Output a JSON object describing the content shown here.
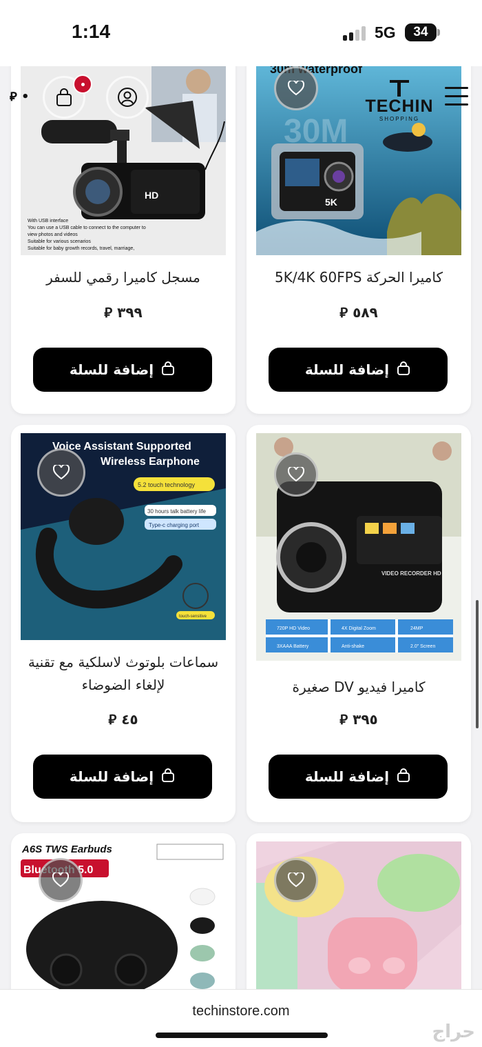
{
  "status_bar": {
    "time": "1:14",
    "network": "5G",
    "battery": "34"
  },
  "header": {
    "logo_text": "TECHIN",
    "logo_subtext": "SHOPPING",
    "cart_count_icon": "bag-icon",
    "currency_symbol": "⃁"
  },
  "products": [
    {
      "title": "مسجل كاميرا رقمي للسفر",
      "price": "٣٩٩",
      "add_label": "إضافة للسلة",
      "image_texts": [
        "With USB interface",
        "You can use a USB cable to connect to the computer to",
        "view photos and videos",
        "Suitable for various scenarios",
        "Suitable for baby growth records, travel, marriage,",
        "HD"
      ]
    },
    {
      "title": "كاميرا الحركة 5K/4K 60FPS",
      "price": "٥٨٩",
      "add_label": "إضافة للسلة",
      "image_texts": [
        "30m waterproof",
        "30M",
        "5K"
      ]
    },
    {
      "title": "سماعات بلوتوث لاسلكية مع تقنية لإلغاء الضوضاء",
      "price": "٤٥",
      "add_label": "إضافة للسلة",
      "image_texts": [
        "Voice Assistant Supported",
        "Wireless Earphone",
        "5.2 touch technology",
        "30 hours talk battery life",
        "Type-c charging port",
        "touch-sensitive"
      ]
    },
    {
      "title": "كاميرا فيديو DV صغيرة",
      "price": "٣٩٥",
      "add_label": "إضافة للسلة",
      "image_texts": [
        "VIDEO RECORDER HD",
        "720P HD Video",
        "4X Digital Zoom",
        "24MP",
        "3XAAA Battery",
        "Anti-shake",
        "2.0\" Screen"
      ]
    },
    {
      "title": "",
      "price": "",
      "add_label": "",
      "image_texts": [
        "A6S TWS Earbuds",
        "Bluetooth 5.0"
      ]
    },
    {
      "title": "",
      "price": "",
      "add_label": "",
      "image_texts": []
    }
  ],
  "footer": {
    "url": "techinstore.com",
    "watermark": "حراج"
  },
  "colors": {
    "button_bg": "#000000",
    "badge": "#c8102e",
    "page_bg": "#f2f2f4"
  }
}
